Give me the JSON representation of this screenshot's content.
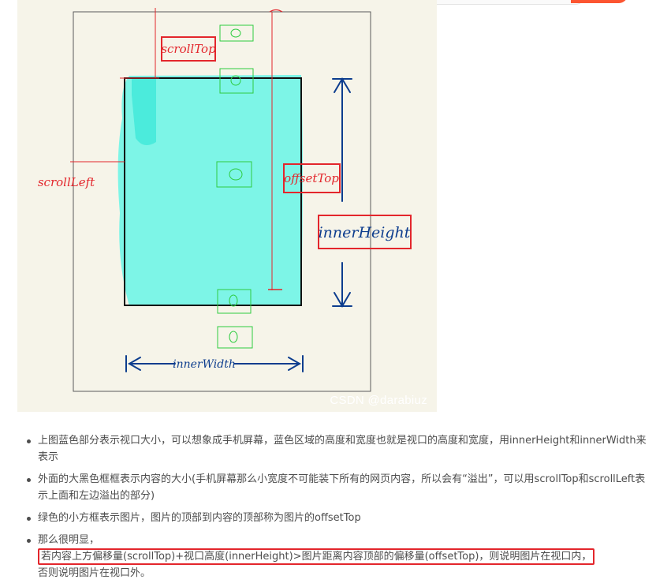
{
  "figure": {
    "labels": {
      "scroll_top": "scrollTop",
      "scroll_left": "scrollLeft",
      "offset_top": "offsetTop",
      "inner_height": "innerHeight",
      "inner_width": "innerWidth"
    },
    "watermark": "CSDN @darabiuz",
    "colors": {
      "canvas": "#f6f4e9",
      "viewport_fill": "#7df5e7",
      "outline_blue": "#0d3d8e",
      "label_red": "#e3262c",
      "image_green": "#2ecc40"
    }
  },
  "notes": [
    {
      "text": "上图蓝色部分表示视口大小，可以想象成手机屏幕，蓝色区域的高度和宽度也就是视口的高度和宽度，用innerHeight和innerWidth来表示"
    },
    {
      "text": "外面的大黑色框框表示内容的大小(手机屏幕那么小宽度不可能装下所有的网页内容，所以会有“溢出”，可以用scrollTop和scrollLeft表示上面和左边溢出的部分)"
    },
    {
      "text": "绿色的小方框表示图片，图片的顶部到内容的顶部称为图片的offsetTop"
    },
    {
      "prefix": "那么很明显，",
      "highlight": "若内容上方偏移量(scrollTop)+视口高度(innerHeight)>图片距离内容顶部的偏移量(offsetTop)，则说明图片在视口内，",
      "suffix": "否则说明图片在视口外。"
    }
  ]
}
